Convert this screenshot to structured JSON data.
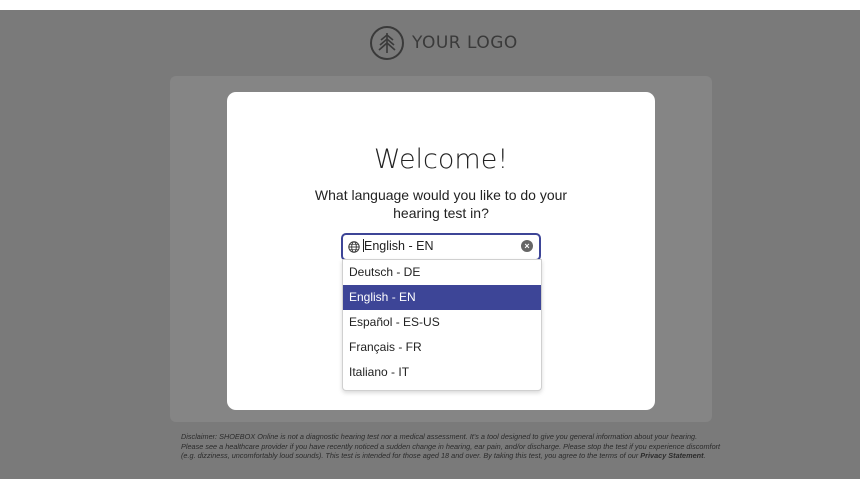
{
  "header": {
    "logo_text": "YOUR LOGO",
    "logo_icon": "tree-icon"
  },
  "modal": {
    "title": "Welcome!",
    "question": "What language would you like to do your hearing test in?"
  },
  "language_select": {
    "value": "English - EN",
    "icon": "globe-icon",
    "clear_icon": "clear-icon",
    "accent_color": "#3d4597",
    "options": [
      {
        "label": "Deutsch - DE",
        "selected": false
      },
      {
        "label": "English - EN",
        "selected": true
      },
      {
        "label": "Español - ES-US",
        "selected": false
      },
      {
        "label": "Français - FR",
        "selected": false
      },
      {
        "label": "Italiano - IT",
        "selected": false
      }
    ]
  },
  "disclaimer": {
    "text": "Disclaimer: SHOEBOX Online is not a diagnostic hearing test nor a medical assessment. It's a tool designed to give you general information about your hearing. Please see a healthcare provider if you have recently noticed a sudden change in hearing, ear pain, and/or discharge. Please stop the test if you experience discomfort (e.g. dizziness, uncomfortably loud sounds). This test is intended for those aged 18 and over. By taking this test, you agree to the terms of our ",
    "link_text": "Privacy Statement",
    "end": "."
  }
}
